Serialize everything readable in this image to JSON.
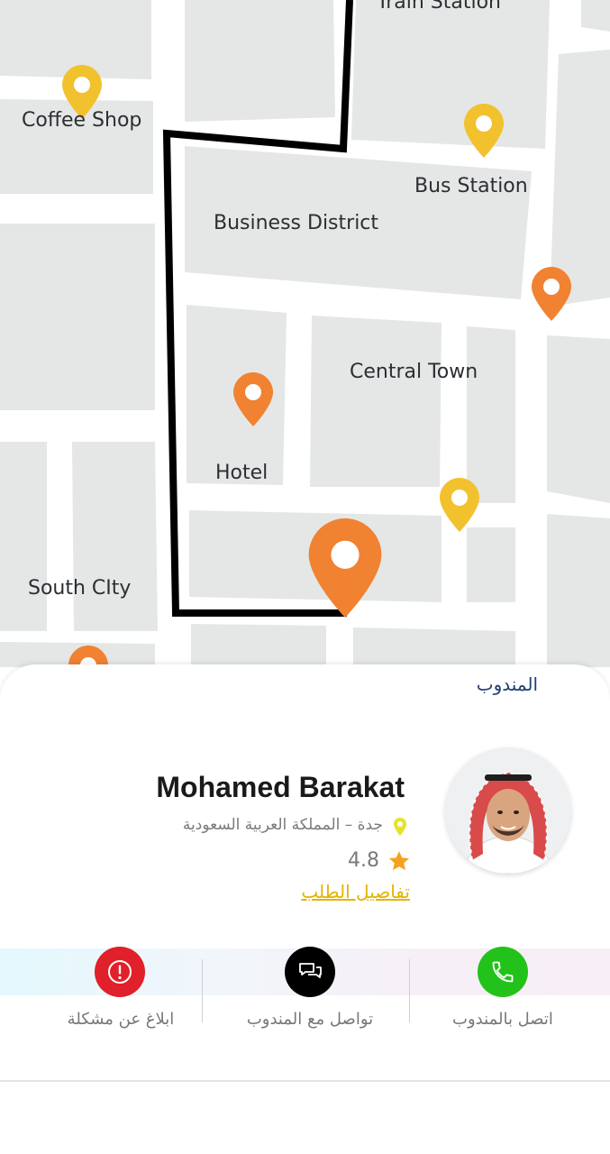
{
  "map": {
    "labels": {
      "train_station": "Train Station",
      "coffee_shop": "Coffee Shop",
      "bus_station": "Bus Station",
      "business_district": "Business District",
      "central_town": "Central Town",
      "hotel": "Hotel",
      "south_city": "South CIty"
    },
    "colors": {
      "block": "#e4e7e6",
      "road": "#ffffff",
      "route": "#000000",
      "pin_yellow": "#f2c12e",
      "pin_orange": "#f08232"
    }
  },
  "sheet": {
    "title": "المندوب",
    "agent": {
      "name": "Mohamed Barakat",
      "location": "جدة – المملكة العربية السعودية",
      "rating": "4.8",
      "details_link": "تفاصيل الطلب"
    },
    "actions": [
      {
        "label": "ابلاغ عن مشكلة",
        "icon": "alert-icon",
        "color": "#e0202a"
      },
      {
        "label": "تواصل مع المندوب",
        "icon": "chat-icon",
        "color": "#000000"
      },
      {
        "label": "اتصل بالمندوب",
        "icon": "phone-icon",
        "color": "#22c21a"
      }
    ]
  }
}
